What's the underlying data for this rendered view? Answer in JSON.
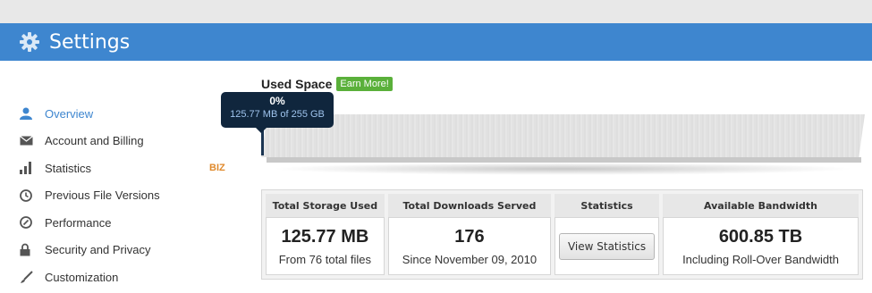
{
  "header": {
    "title": "Settings",
    "icon": "gear-icon"
  },
  "sidebar": {
    "items": [
      {
        "label": "Overview",
        "icon": "user-icon",
        "active": true
      },
      {
        "label": "Account and Billing",
        "icon": "envelope-icon"
      },
      {
        "label": "Statistics",
        "icon": "bar-chart-icon",
        "badge": "BIZ"
      },
      {
        "label": "Previous File Versions",
        "icon": "clock-icon"
      },
      {
        "label": "Performance",
        "icon": "gauge-icon"
      },
      {
        "label": "Security and Privacy",
        "icon": "lock-icon"
      },
      {
        "label": "Customization",
        "icon": "brush-icon"
      }
    ]
  },
  "used_space": {
    "label": "Used Space",
    "earn_more": "Earn More!",
    "percent": "0%",
    "amount": "125.77 MB of 255 GB",
    "fill_fraction": 0.0005
  },
  "stats": [
    {
      "header": "Total Storage Used",
      "value": "125.77 MB",
      "sub": "From 76 total files"
    },
    {
      "header": "Total Downloads Served",
      "value": "176",
      "sub": "Since November 09, 2010"
    },
    {
      "header": "Statistics",
      "button": "View Statistics"
    },
    {
      "header": "Available Bandwidth",
      "value": "600.85 TB",
      "sub": "Including Roll-Over Bandwidth"
    }
  ],
  "colors": {
    "header_bg": "#3e86cf",
    "active_link": "#3e86cf",
    "badge": "#e08a2c",
    "earn_more_bg": "#5ab03a",
    "tooltip_bg": "#10263d"
  }
}
